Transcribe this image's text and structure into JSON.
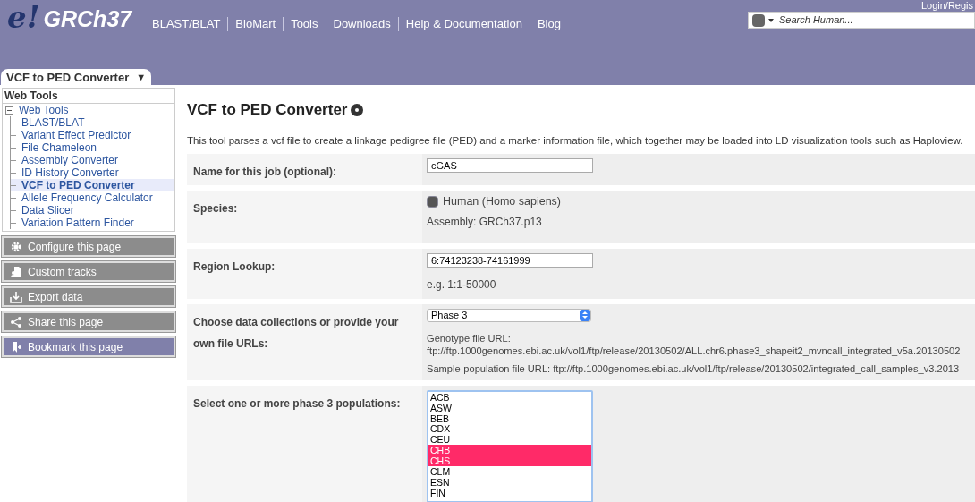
{
  "header": {
    "logo_mark": "e!",
    "logo_text": "GRCh37",
    "nav": [
      "BLAST/BLAT",
      "BioMart",
      "Tools",
      "Downloads",
      "Help & Documentation",
      "Blog"
    ],
    "login": "Login/Regis",
    "search": {
      "placeholder": "Search Human..."
    }
  },
  "page_tab": {
    "label": "VCF to PED Converter",
    "caret": "▼"
  },
  "sidebar": {
    "title": "Web Tools",
    "tree": {
      "label": "Web Tools",
      "expanded": true,
      "children": [
        {
          "label": "BLAST/BLAT",
          "selected": false
        },
        {
          "label": "Variant Effect Predictor",
          "selected": false
        },
        {
          "label": "File Chameleon",
          "selected": false
        },
        {
          "label": "Assembly Converter",
          "selected": false
        },
        {
          "label": "ID History Converter",
          "selected": false
        },
        {
          "label": "VCF to PED Converter",
          "selected": true
        },
        {
          "label": "Allele Frequency Calculator",
          "selected": false
        },
        {
          "label": "Data Slicer",
          "selected": false
        },
        {
          "label": "Variation Pattern Finder",
          "selected": false
        }
      ]
    },
    "actions": [
      {
        "kind": "configure",
        "label": "Configure this page"
      },
      {
        "kind": "tracks",
        "label": "Custom tracks"
      },
      {
        "kind": "export",
        "label": "Export data"
      },
      {
        "kind": "share",
        "label": "Share this page"
      },
      {
        "kind": "bookmark",
        "label": "Bookmark this page"
      }
    ]
  },
  "main": {
    "title": "VCF to PED Converter",
    "description": "This tool parses a vcf file to create a linkage pedigree file (PED) and a marker information file, which together may be loaded into LD visualization tools such as Haploview.",
    "form": [
      {
        "kind": "text",
        "label": "Name for this job (optional):",
        "value": "cGAS"
      },
      {
        "kind": "species",
        "label": "Species:",
        "species": "Human (Homo sapiens)",
        "note": "Assembly: GRCh37.p13"
      },
      {
        "kind": "text",
        "label": "Region Lookup:",
        "value": "6:74123238-74161999",
        "note": "e.g. 1:1-50000"
      },
      {
        "kind": "select",
        "label": "Choose data collections or provide your own file URLs:",
        "value": "Phase 3",
        "lines": [
          "Genotype file URL:",
          "ftp://ftp.1000genomes.ebi.ac.uk/vol1/ftp/release/20130502/ALL.chr6.phase3_shapeit2_mvncall_integrated_v5a.20130502",
          "Sample-population file URL: ftp://ftp.1000genomes.ebi.ac.uk/vol1/ftp/release/20130502/integrated_call_samples_v3.2013"
        ]
      },
      {
        "kind": "listbox",
        "label": "Select one or more phase 3 populations:",
        "options": [
          {
            "label": "ACB",
            "selected": false
          },
          {
            "label": "ASW",
            "selected": false
          },
          {
            "label": "BEB",
            "selected": false
          },
          {
            "label": "CDX",
            "selected": false
          },
          {
            "label": "CEU",
            "selected": false
          },
          {
            "label": "CHB",
            "selected": true
          },
          {
            "label": "CHS",
            "selected": true
          },
          {
            "label": "CLM",
            "selected": false
          },
          {
            "label": "ESN",
            "selected": false
          },
          {
            "label": "FIN",
            "selected": false
          }
        ]
      }
    ]
  }
}
